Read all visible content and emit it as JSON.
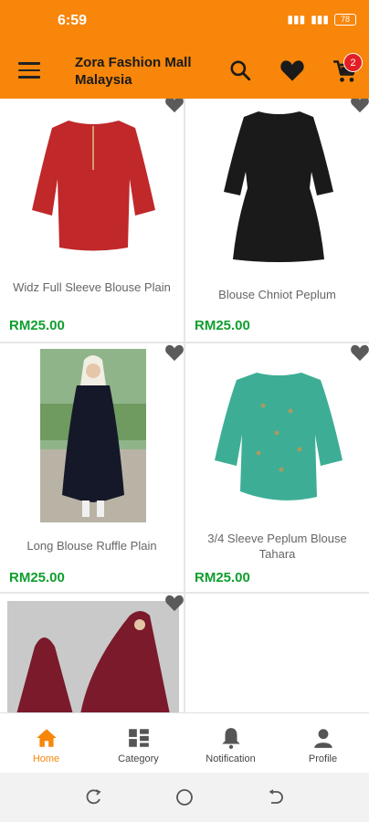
{
  "status": {
    "time": "6:59",
    "battery": "78"
  },
  "header": {
    "title": "Zora Fashion Mall Malaysia",
    "cart_count": "2"
  },
  "products": [
    {
      "name": "Widz Full Sleeve Blouse Plain",
      "price": "RM25.00",
      "color": "#c0282a"
    },
    {
      "name": "Blouse Chniot Peplum",
      "price": "RM25.00",
      "color": "#1a1a1a"
    },
    {
      "name": "Long Blouse Ruffle Plain",
      "price": "RM25.00",
      "color": "#151828"
    },
    {
      "name": "3/4 Sleeve Peplum Blouse Tahara",
      "price": "RM25.00",
      "color": "#3dae95"
    },
    {
      "name": "",
      "price": "",
      "color": "#7a1a2a"
    }
  ],
  "nav": [
    {
      "label": "Home",
      "icon": "home-icon",
      "active": true
    },
    {
      "label": "Category",
      "icon": "category-icon"
    },
    {
      "label": "Notification",
      "icon": "bell-icon"
    },
    {
      "label": "Profile",
      "icon": "person-icon"
    }
  ],
  "colors": {
    "brand": "#f7860a",
    "price": "#0f9e2e",
    "badge": "#e31e24"
  }
}
